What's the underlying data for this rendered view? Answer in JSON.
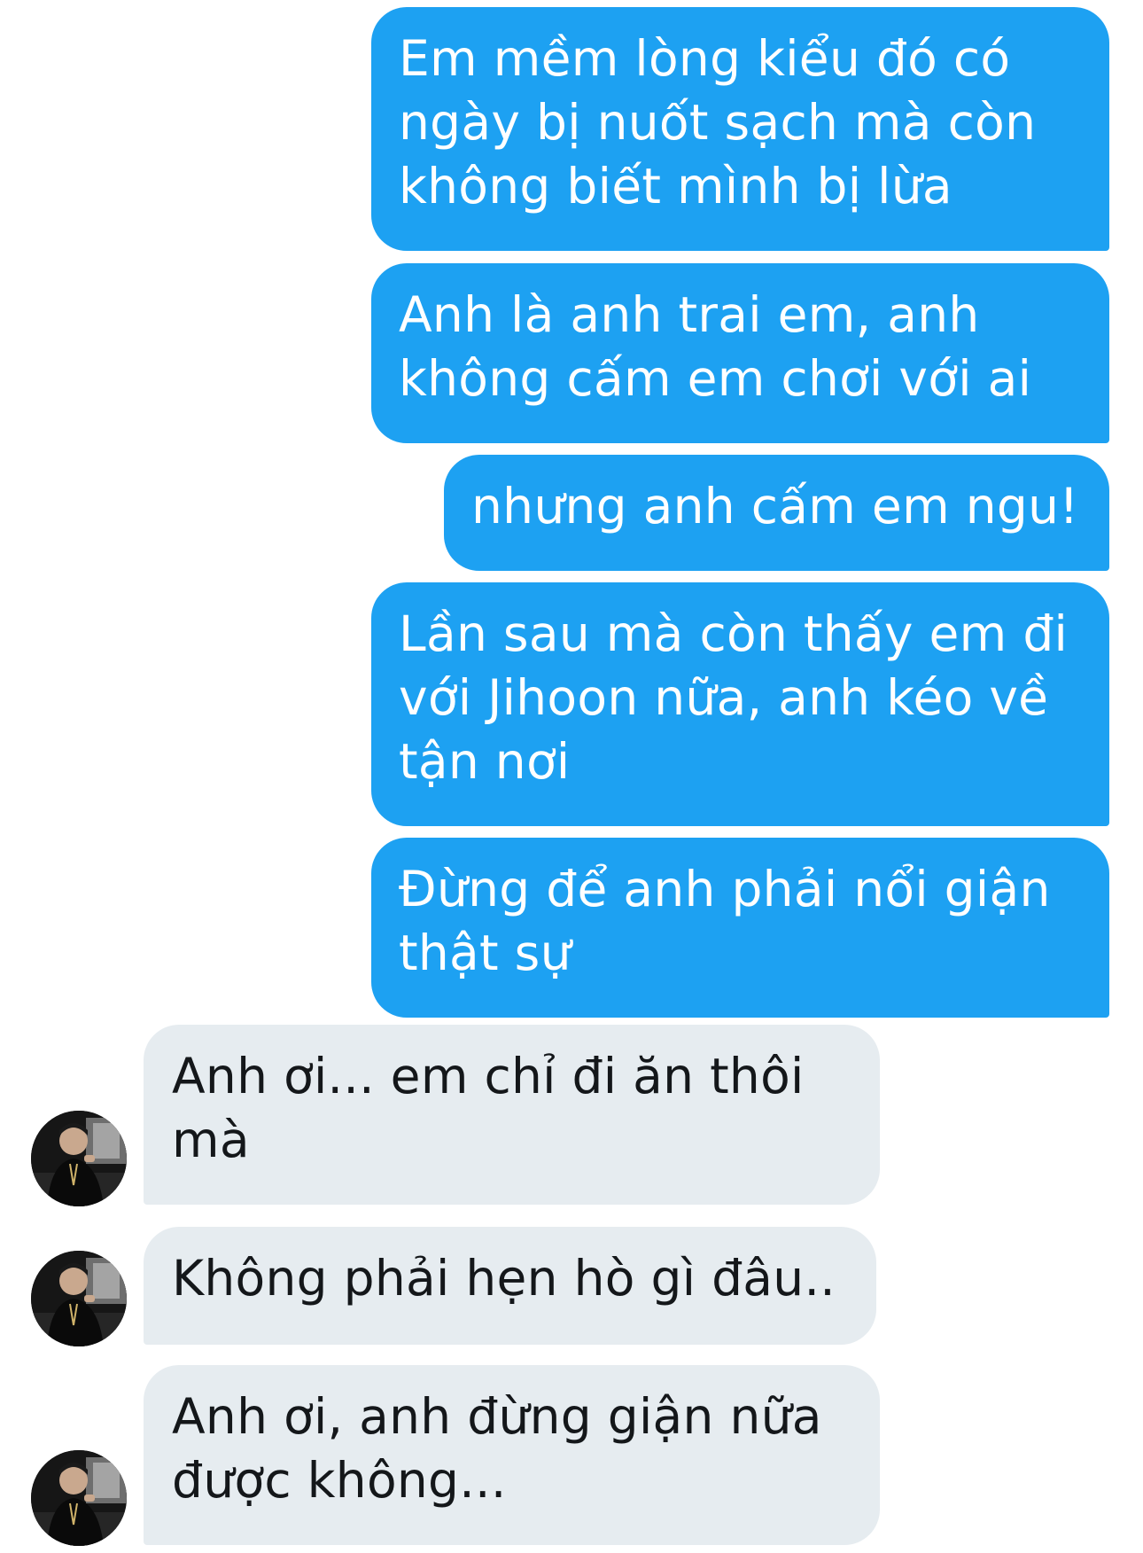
{
  "conversation": {
    "sent_messages": [
      {
        "text": "Em mềm lòng kiểu đó có\nngày bị nuốt sạch mà còn\nkhông biết mình bị lừa"
      },
      {
        "text": "Anh là anh trai em, anh\nkhông cấm em chơi với ai"
      },
      {
        "text": "nhưng anh cấm em ngu!"
      },
      {
        "text": "Lần sau mà còn thấy em đi\nvới Jihoon nữa, anh kéo về\ntận nơi"
      },
      {
        "text": "Đừng để anh phải nổi giận\nthật sự"
      }
    ],
    "received_messages": [
      {
        "text": "Anh ơi... em chỉ đi ăn thôi\nmà",
        "avatar_icon": "profile-photo-icon"
      },
      {
        "text": "Không phải hẹn hò gì đâu..",
        "avatar_icon": "profile-photo-icon"
      },
      {
        "text": "Anh ơi, anh đừng giận nữa\nđược không...",
        "avatar_icon": "profile-photo-icon"
      }
    ]
  },
  "colors": {
    "sent_bubble": "#1da1f2",
    "sent_text": "#ffffff",
    "received_bubble": "#e6ecf0",
    "received_text": "#14171a",
    "background": "#ffffff"
  }
}
